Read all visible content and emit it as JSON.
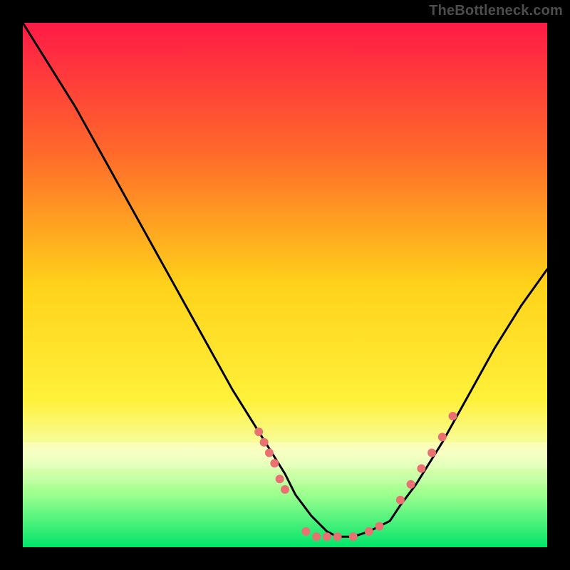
{
  "attribution": "TheBottleneck.com",
  "chart_data": {
    "type": "line",
    "title": "",
    "xlabel": "",
    "ylabel": "",
    "xlim": [
      0,
      100
    ],
    "ylim": [
      0,
      100
    ],
    "grid": false,
    "legend": false,
    "gradient_stops": [
      {
        "offset": 0,
        "color": "#ff1a47"
      },
      {
        "offset": 25,
        "color": "#ff6a2a"
      },
      {
        "offset": 50,
        "color": "#ffd21a"
      },
      {
        "offset": 72,
        "color": "#fff13a"
      },
      {
        "offset": 82,
        "color": "#f6ffb0"
      },
      {
        "offset": 90,
        "color": "#9bff8e"
      },
      {
        "offset": 100,
        "color": "#00e46a"
      }
    ],
    "series": [
      {
        "name": "bottleneck-curve",
        "x": [
          0,
          5,
          10,
          15,
          20,
          25,
          30,
          35,
          40,
          45,
          50,
          52,
          55,
          58,
          60,
          63,
          66,
          70,
          72,
          75,
          80,
          85,
          90,
          95,
          100
        ],
        "y": [
          100,
          92,
          84,
          75,
          66,
          57,
          48,
          39,
          30,
          22,
          14,
          10,
          6,
          3,
          2,
          2,
          3,
          5,
          8,
          12,
          20,
          29,
          38,
          46,
          53
        ]
      }
    ],
    "markers": {
      "name": "gpu-points",
      "color": "#e97172",
      "radius": 6,
      "points": [
        {
          "x": 45,
          "y": 22
        },
        {
          "x": 46,
          "y": 20
        },
        {
          "x": 47,
          "y": 18
        },
        {
          "x": 48,
          "y": 16
        },
        {
          "x": 49,
          "y": 13
        },
        {
          "x": 50,
          "y": 11
        },
        {
          "x": 54,
          "y": 3
        },
        {
          "x": 56,
          "y": 2
        },
        {
          "x": 58,
          "y": 2
        },
        {
          "x": 60,
          "y": 2
        },
        {
          "x": 63,
          "y": 2
        },
        {
          "x": 66,
          "y": 3
        },
        {
          "x": 68,
          "y": 4
        },
        {
          "x": 72,
          "y": 9
        },
        {
          "x": 74,
          "y": 12
        },
        {
          "x": 76,
          "y": 15
        },
        {
          "x": 78,
          "y": 18
        },
        {
          "x": 80,
          "y": 21
        },
        {
          "x": 82,
          "y": 25
        }
      ]
    }
  }
}
